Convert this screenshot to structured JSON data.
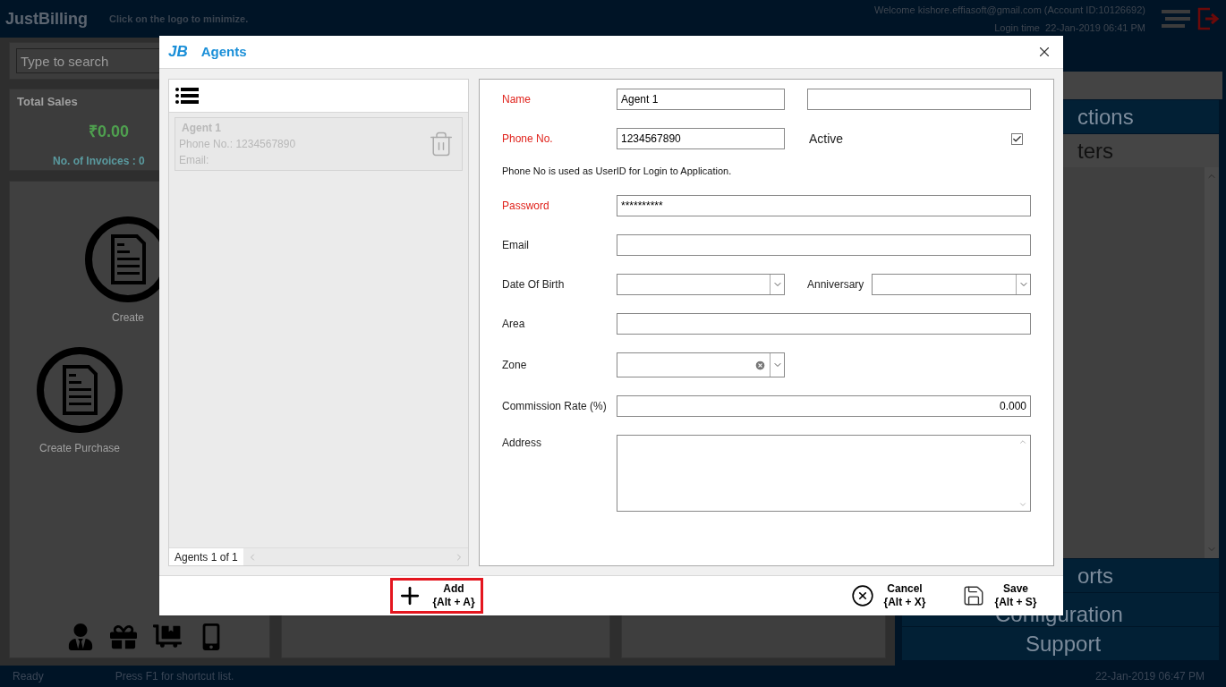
{
  "header": {
    "logo": "JustBilling",
    "hint": "Click on the logo to minimize.",
    "welcome": "Welcome kishore.effiasoft@gmail.com (Account ID:10126692)",
    "login_time": "Login time  22-Jan-2019 06:41 PM"
  },
  "left": {
    "search": {
      "placeholder": "Type to search"
    },
    "total_sales": {
      "title": "Total Sales",
      "amount": "₹0.00",
      "invoices": "No. of Invoices : 0"
    },
    "tiles": [
      {
        "label": "Create"
      },
      {
        "label": "Create Purchase"
      }
    ]
  },
  "right_menu": [
    {
      "label": "ctions",
      "expanded": false
    },
    {
      "label": "ters",
      "expanded": true
    },
    {
      "label": "orts",
      "expanded": false
    },
    {
      "label": "Configuration",
      "expanded": false
    },
    {
      "label": "Support",
      "expanded": false
    }
  ],
  "status_bar": {
    "state": "Ready",
    "hint": "Press F1 for shortcut list.",
    "time": "22-Jan-2019 06:47 PM"
  },
  "dialog": {
    "logo": "JB",
    "title": "Agents",
    "agents": [
      {
        "name": "Agent 1",
        "phone": "Phone No.: 1234567890",
        "email": "Email:"
      }
    ],
    "pager": "Agents 1 of 1",
    "form": [
      {
        "kind": "split",
        "label": "Name",
        "required": true,
        "value": "Agent 1"
      },
      {
        "kind": "check",
        "label": "Phone No.",
        "required": true,
        "value": "1234567890",
        "check_label": "Active",
        "checked": true
      },
      {
        "kind": "note",
        "text": "Phone No is used as UserID for Login to Application."
      },
      {
        "kind": "text",
        "label": "Password",
        "required": true,
        "value": "**********"
      },
      {
        "kind": "text",
        "label": "Email",
        "required": false
      },
      {
        "kind": "dates",
        "label": "Date Of Birth",
        "required": false,
        "second_label": "Anniversary"
      },
      {
        "kind": "text",
        "label": "Area",
        "required": false
      },
      {
        "kind": "combo",
        "label": "Zone",
        "required": false
      },
      {
        "kind": "number",
        "label": "Commission Rate (%)",
        "required": false,
        "value": "0.000"
      },
      {
        "kind": "textarea",
        "label": "Address",
        "required": false
      }
    ],
    "buttons": [
      {
        "kind": "add",
        "label": "Add",
        "shortcut": "{Alt + A}",
        "focused": true
      },
      {
        "kind": "cancel",
        "label": "Cancel",
        "shortcut": "{Alt + X}",
        "focused": false
      },
      {
        "kind": "save",
        "label": "Save",
        "shortcut": "{Alt + S}",
        "focused": false
      }
    ]
  }
}
